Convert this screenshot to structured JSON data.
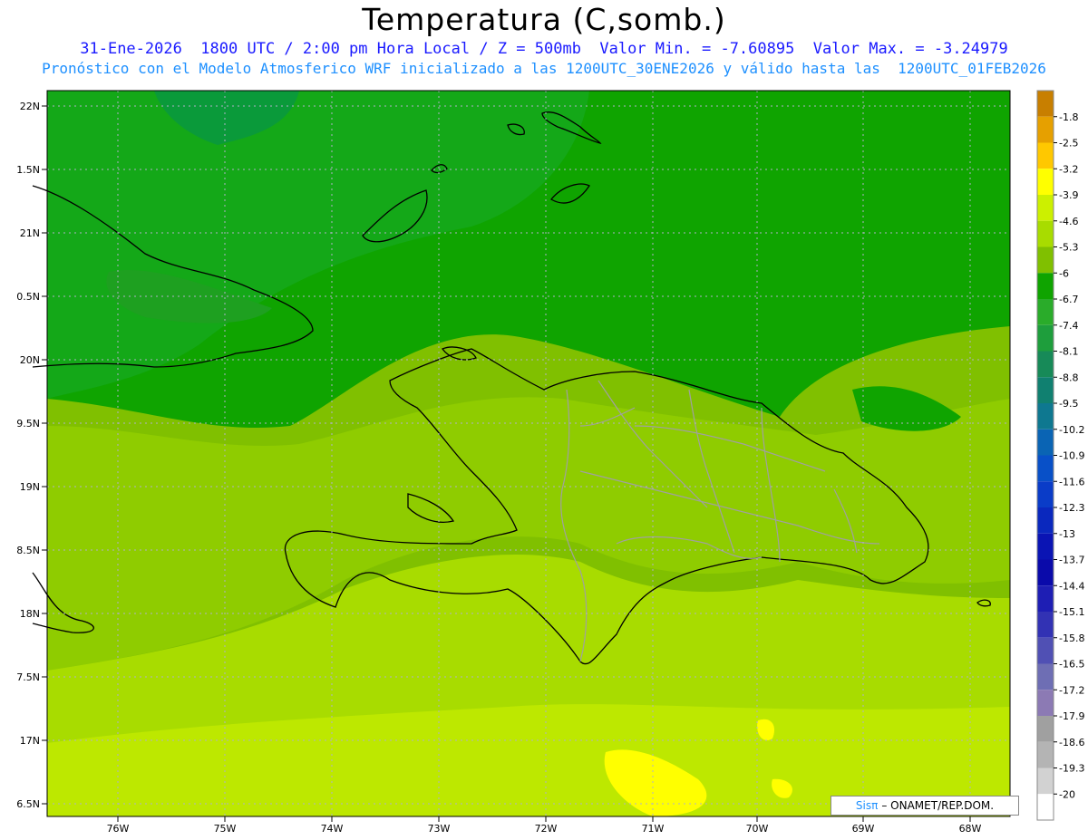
{
  "header": {
    "title": "Temperatura (C,somb.)",
    "subtitle1": "31-Ene-2026  1800 UTC / 2:00 pm Hora Local / Z = 500mb  Valor Min. = -7.60895  Valor Max. = -3.24979",
    "subtitle2": "Pronóstico con el Modelo Atmosferico WRF inicializado a las 1200UTC_30ENE2026 y válido hasta las  1200UTC_01FEB2026"
  },
  "axes": {
    "lat_labels": [
      "22N",
      "1.5N",
      "21N",
      "0.5N",
      "20N",
      "9.5N",
      "19N",
      "8.5N",
      "18N",
      "7.5N",
      "17N",
      "6.5N"
    ],
    "lon_labels": [
      "76W",
      "75W",
      "74W",
      "73W",
      "72W",
      "71W",
      "70W",
      "69W",
      "68W"
    ]
  },
  "colorbar": {
    "labels": [
      "-1.8",
      "-2.5",
      "-3.2",
      "-3.9",
      "-4.6",
      "-5.3",
      "-6",
      "-6.7",
      "-7.4",
      "-8.1",
      "-8.8",
      "-9.5",
      "-10.2",
      "-10.9",
      "-11.6",
      "-12.3",
      "-13",
      "-13.7",
      "-14.4",
      "-15.1",
      "-15.8",
      "-16.5",
      "-17.2",
      "-17.9",
      "-18.6",
      "-19.3",
      "-20"
    ],
    "colors": [
      "#c87f00",
      "#e6a000",
      "#ffc800",
      "#ffff00",
      "#ccf000",
      "#a8dc00",
      "#80c000",
      "#0fa400",
      "#2aac2a",
      "#1e9e3c",
      "#178a58",
      "#108070",
      "#0e7890",
      "#0a64b4",
      "#0850c8",
      "#0a3cc8",
      "#0a28be",
      "#0a14b4",
      "#0a0aaa",
      "#1e1eb4",
      "#3232b4",
      "#5050b4",
      "#6e6eb4",
      "#8c7ab4",
      "#a0a0a0",
      "#b4b4b4",
      "#d2d2d2",
      "#ffffff"
    ]
  },
  "credit": {
    "sis": "Sisπ",
    "text": "– ONAMET/REP.DOM."
  }
}
